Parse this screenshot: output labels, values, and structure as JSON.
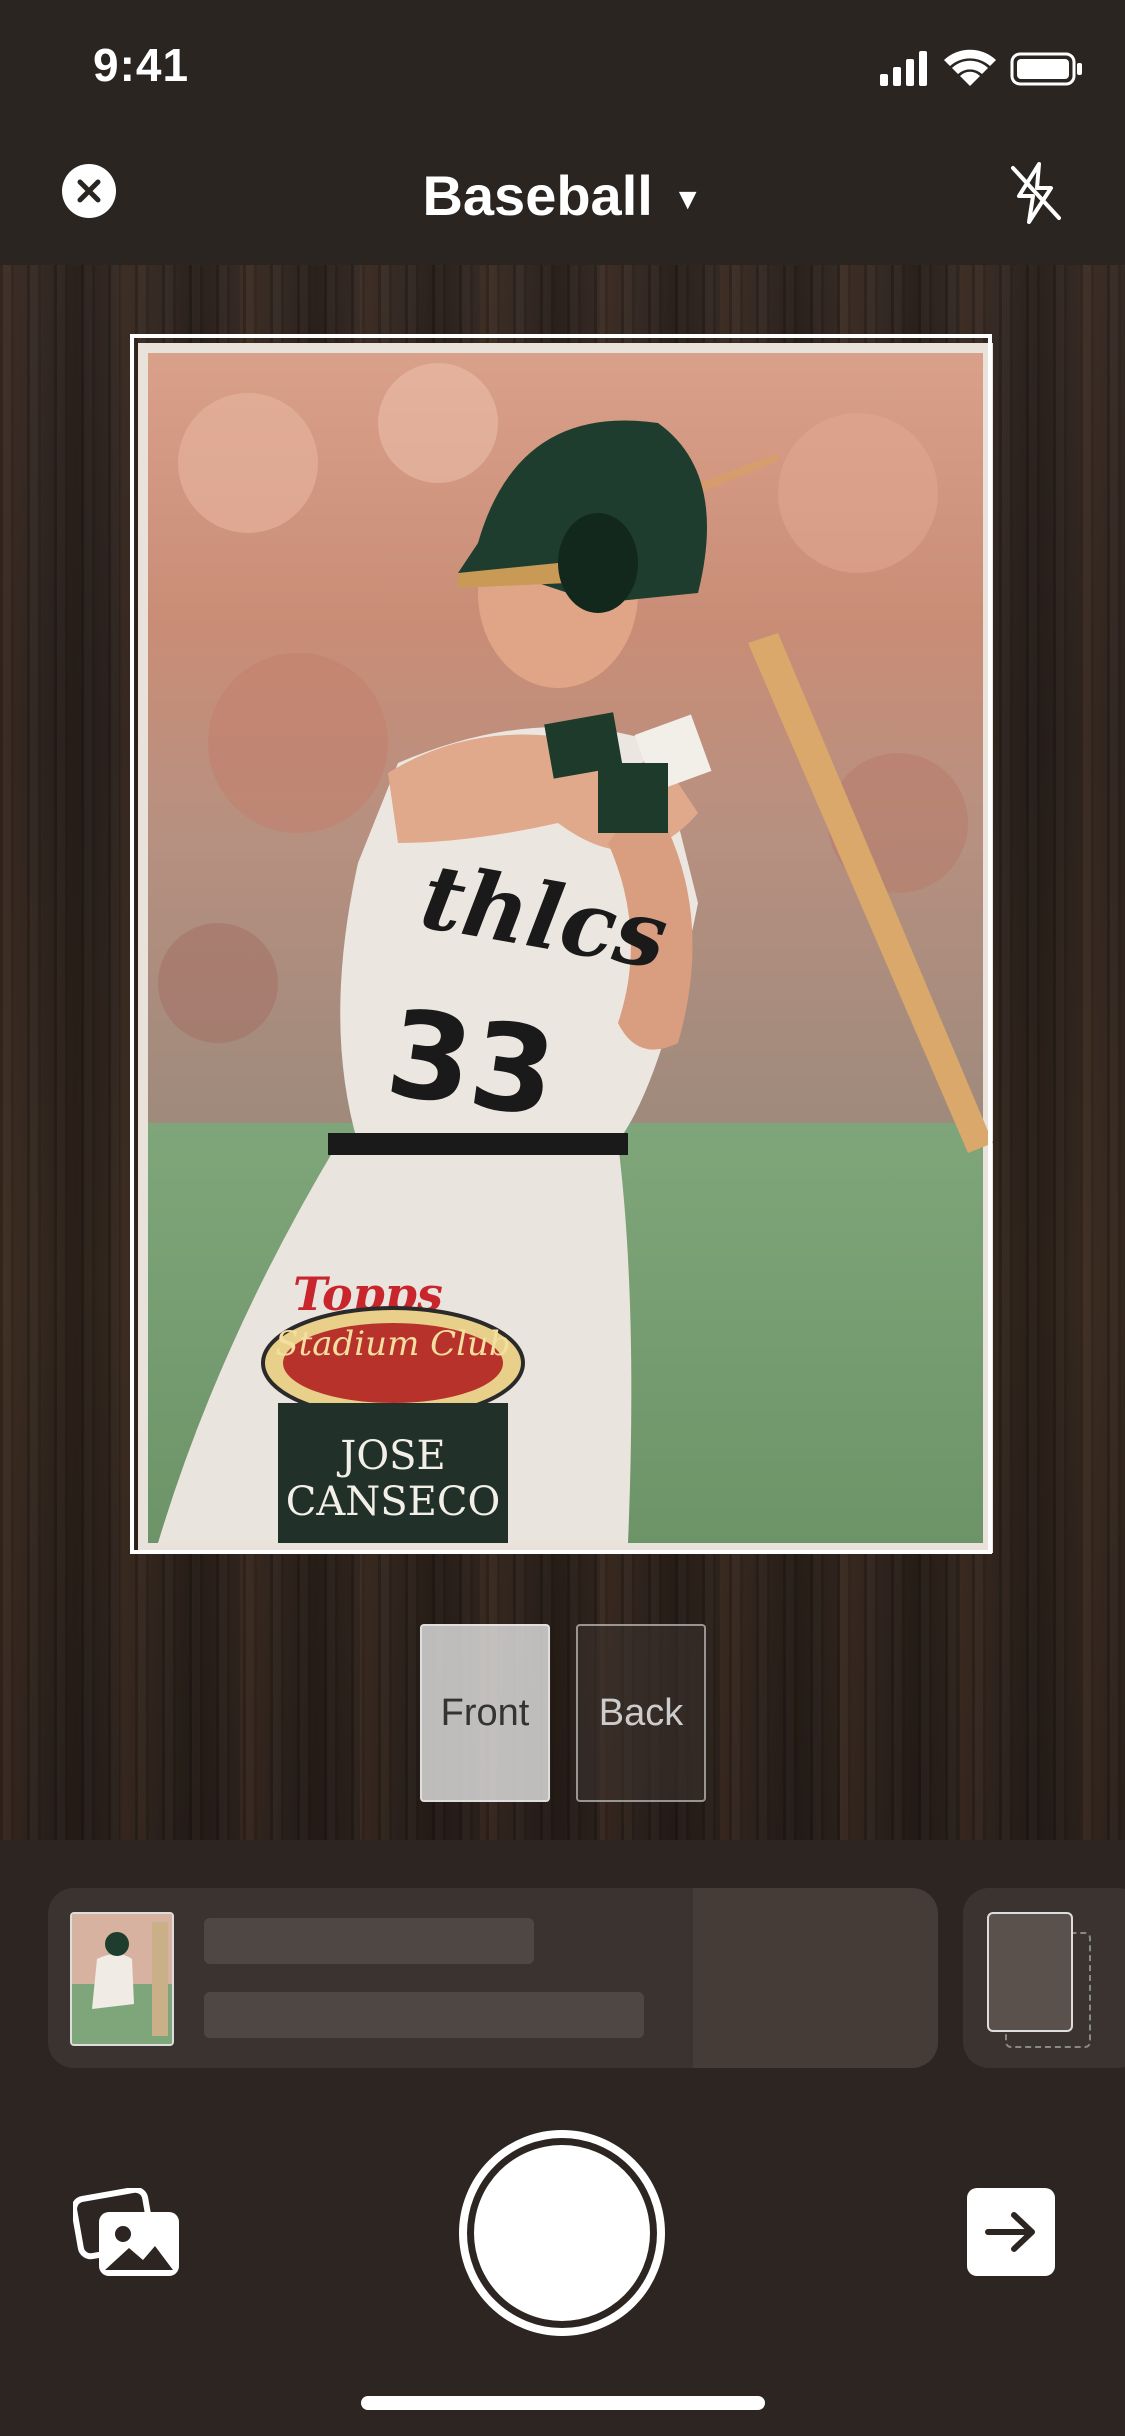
{
  "status_bar": {
    "time": "9:41"
  },
  "header": {
    "sport": "Baseball",
    "caret": "▼"
  },
  "card": {
    "brand": "Topps",
    "set_name": "Stadium Club",
    "player_name_line1": "JOSE",
    "player_name_line2": "CANSECO",
    "jersey_number": "33"
  },
  "side_toggle": {
    "front_label": "Front",
    "back_label": "Back",
    "selected": "Front"
  },
  "icons": {
    "close": "close-icon",
    "flash": "flash-off-icon",
    "gallery": "photo-gallery-icon",
    "continue": "arrow-right-icon"
  },
  "colors": {
    "background": "#2c2522",
    "frame": "#ffffff"
  }
}
